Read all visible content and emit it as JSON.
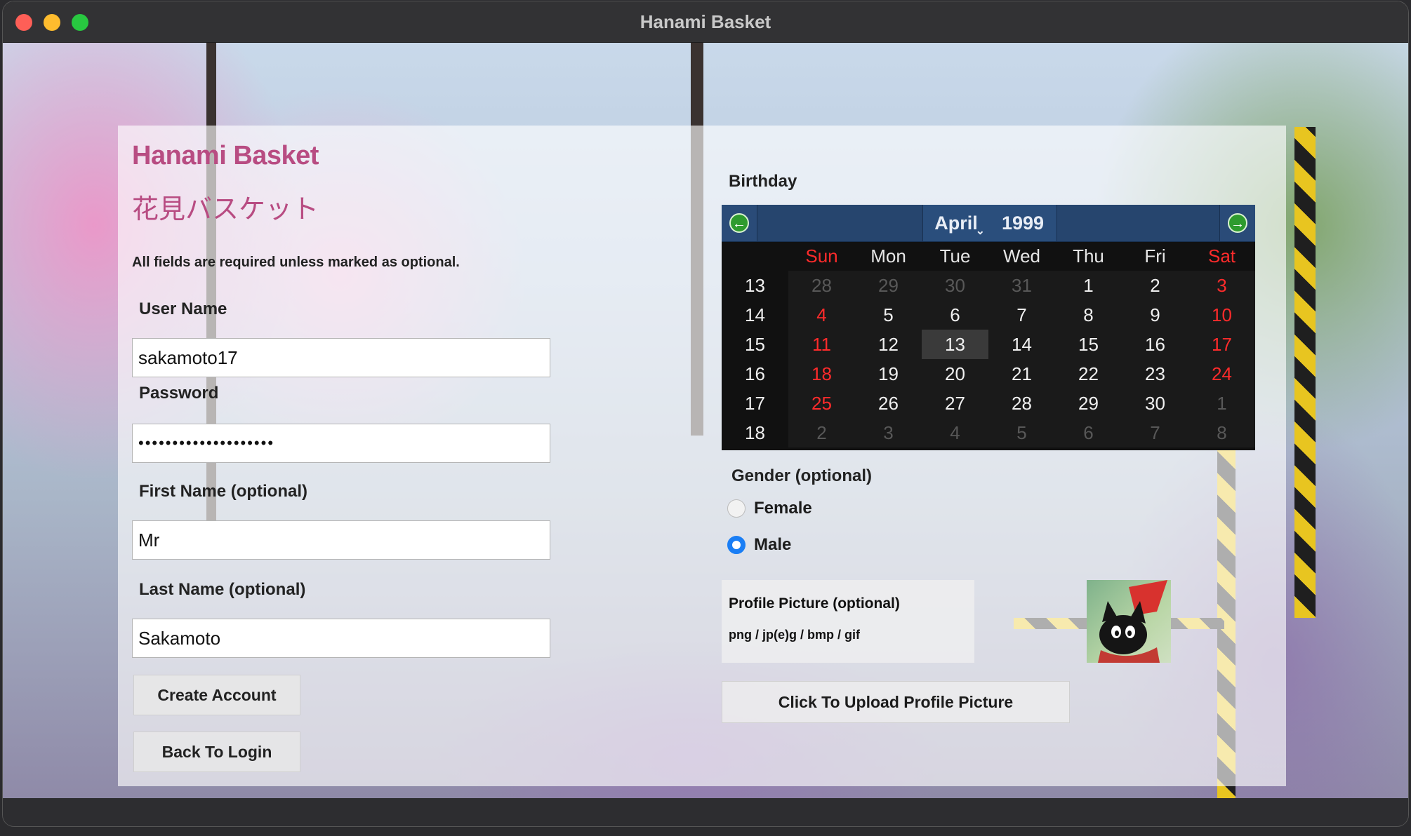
{
  "window": {
    "title": "Hanami Basket"
  },
  "app": {
    "title": "Hanami Basket",
    "subtitle": "花見バスケット",
    "note": "All fields are required unless marked as optional."
  },
  "form": {
    "username": {
      "label": "User Name",
      "value": "sakamoto17"
    },
    "password": {
      "label": "Password",
      "value": "••••••••••••••••••••"
    },
    "first_name": {
      "label": "First Name (optional)",
      "value": "Mr"
    },
    "last_name": {
      "label": "Last Name (optional)",
      "value": "Sakamoto"
    },
    "create_button": "Create Account",
    "back_button": "Back To Login"
  },
  "birthday": {
    "label": "Birthday",
    "month": "April",
    "year": "1999",
    "weekday_headers": [
      "Sun",
      "Mon",
      "Tue",
      "Wed",
      "Thu",
      "Fri",
      "Sat"
    ],
    "selected_day": "13",
    "weeks": [
      {
        "week": "13",
        "days": [
          {
            "d": "28",
            "other": true
          },
          {
            "d": "29",
            "other": true
          },
          {
            "d": "30",
            "other": true
          },
          {
            "d": "31",
            "other": true
          },
          {
            "d": "1"
          },
          {
            "d": "2"
          },
          {
            "d": "3"
          }
        ]
      },
      {
        "week": "14",
        "days": [
          {
            "d": "4"
          },
          {
            "d": "5"
          },
          {
            "d": "6"
          },
          {
            "d": "7"
          },
          {
            "d": "8"
          },
          {
            "d": "9"
          },
          {
            "d": "10"
          }
        ]
      },
      {
        "week": "15",
        "days": [
          {
            "d": "11"
          },
          {
            "d": "12"
          },
          {
            "d": "13",
            "selected": true
          },
          {
            "d": "14"
          },
          {
            "d": "15"
          },
          {
            "d": "16"
          },
          {
            "d": "17"
          }
        ]
      },
      {
        "week": "16",
        "days": [
          {
            "d": "18"
          },
          {
            "d": "19"
          },
          {
            "d": "20"
          },
          {
            "d": "21"
          },
          {
            "d": "22"
          },
          {
            "d": "23"
          },
          {
            "d": "24"
          }
        ]
      },
      {
        "week": "17",
        "days": [
          {
            "d": "25"
          },
          {
            "d": "26"
          },
          {
            "d": "27"
          },
          {
            "d": "28"
          },
          {
            "d": "29"
          },
          {
            "d": "30"
          },
          {
            "d": "1",
            "other": true
          }
        ]
      },
      {
        "week": "18",
        "days": [
          {
            "d": "2",
            "other": true
          },
          {
            "d": "3",
            "other": true
          },
          {
            "d": "4",
            "other": true
          },
          {
            "d": "5",
            "other": true
          },
          {
            "d": "6",
            "other": true
          },
          {
            "d": "7",
            "other": true
          },
          {
            "d": "8",
            "other": true
          }
        ]
      }
    ]
  },
  "gender": {
    "label": "Gender (optional)",
    "options": [
      {
        "label": "Female",
        "selected": false
      },
      {
        "label": "Male",
        "selected": true
      }
    ]
  },
  "profile_picture": {
    "title": "Profile Picture (optional)",
    "formats": "png / jp(e)g / bmp / gif",
    "upload_button": "Click To Upload Profile Picture"
  },
  "colors": {
    "brand": "#b84c82",
    "weekend": "#ff2b2b",
    "calendar_header": "#26456e",
    "radio_selected": "#1a7ef5"
  }
}
